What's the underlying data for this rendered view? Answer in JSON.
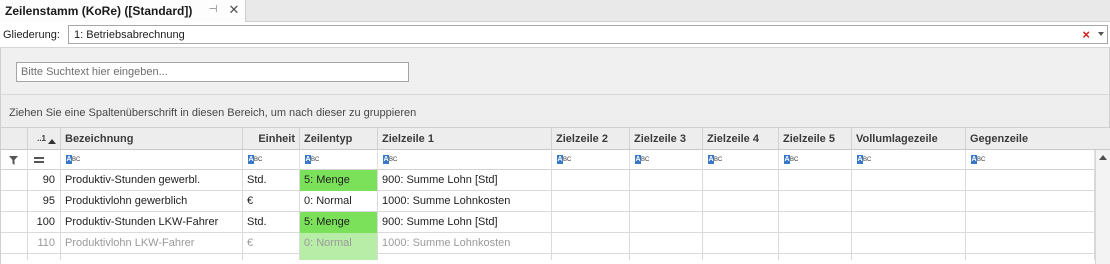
{
  "tab": {
    "title": "Zeilenstamm (KoRe) ([Standard])"
  },
  "gliederung": {
    "label": "Gliederung:",
    "value": "1: Betriebsabrechnung"
  },
  "search": {
    "placeholder": "Bitte Suchtext hier eingeben..."
  },
  "group_panel": {
    "text": "Ziehen Sie eine Spaltenüberschrift in diesen Bereich, um nach dieser zu gruppieren"
  },
  "grid": {
    "sort_indicator": "..1",
    "columns": {
      "bezeichnung": "Bezeichnung",
      "einheit": "Einheit",
      "zeilentyp": "Zeilentyp",
      "zielzeile1": "Zielzeile 1",
      "zielzeile2": "Zielzeile 2",
      "zielzeile3": "Zielzeile 3",
      "zielzeile4": "Zielzeile 4",
      "zielzeile5": "Zielzeile 5",
      "vollumlagezeile": "Vollumlagezeile",
      "gegenzeile": "Gegenzeile"
    },
    "filter_glyph": {
      "a": "A",
      "bc": "BC"
    },
    "rows": [
      {
        "nr": "90",
        "bezeichnung": "Produktiv-Stunden gewerbl.",
        "einheit": "Std.",
        "zeilentyp": "5: Menge",
        "zielzeile1": "900: Summe Lohn [Std]"
      },
      {
        "nr": "95",
        "bezeichnung": "Produktivlohn gewerblich",
        "einheit": "€",
        "zeilentyp": "0: Normal",
        "zielzeile1": "1000: Summe Lohnkosten"
      },
      {
        "nr": "100",
        "bezeichnung": "Produktiv-Stunden LKW-Fahrer",
        "einheit": "Std.",
        "zeilentyp": "5: Menge",
        "zielzeile1": "900: Summe Lohn [Std]"
      },
      {
        "nr": "110",
        "bezeichnung": "Produktivlohn LKW-Fahrer",
        "einheit": "€",
        "zeilentyp": "0: Normal",
        "zielzeile1": "1000: Summe Lohnkosten"
      }
    ]
  },
  "colors": {
    "menge_highlight": "#7ce15a",
    "clear_x": "#d11c1c",
    "abc_badge": "#3a78c9"
  }
}
